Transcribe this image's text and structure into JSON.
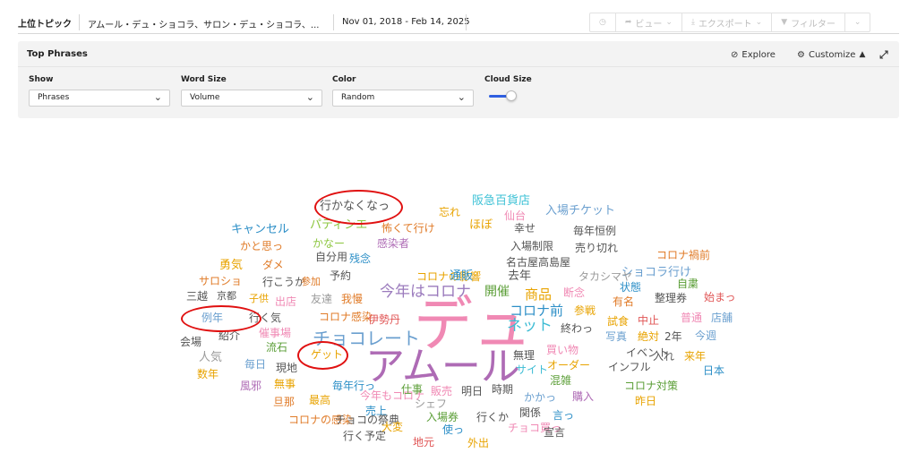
{
  "header": {
    "title": "上位トピック",
    "query": "アムール・デュ・ショコラ、サロン・デュ・ショコラ、...",
    "date_range": "Nov 01, 2018 - Feb 14, 2025",
    "controls": {
      "view_label": "ビュー",
      "export_label": "エクスポート",
      "filter_label": "フィルター"
    }
  },
  "panel": {
    "title": "Top Phrases",
    "explore_label": "Explore",
    "customize_label": "Customize",
    "fields": {
      "show": {
        "label": "Show",
        "value": "Phrases"
      },
      "word_size": {
        "label": "Word Size",
        "value": "Volume"
      },
      "color": {
        "label": "Color",
        "value": "Random"
      },
      "cloud_size": {
        "label": "Cloud Size"
      }
    }
  },
  "cloud_words": [
    {
      "text": "デュ",
      "color": "#f089b4"
    },
    {
      "text": "アムール",
      "color": "#ae6bb5"
    },
    {
      "text": "チョコレート",
      "color": "#6a9fcf"
    },
    {
      "text": "今年はコロナ",
      "color": "#9b7bbd"
    },
    {
      "text": "ネット",
      "color": "#3dbcd4"
    },
    {
      "text": "コロナ前",
      "color": "#2d8fc7"
    },
    {
      "text": "商品",
      "color": "#e8a300"
    },
    {
      "text": "開催",
      "color": "#5b9e37"
    },
    {
      "text": "行かなくなっ",
      "color": "#555555"
    },
    {
      "text": "阪急百貨店",
      "color": "#3ec2d6"
    },
    {
      "text": "忘れ",
      "color": "#e8a300"
    },
    {
      "text": "仙台",
      "color": "#f089b4"
    },
    {
      "text": "入場チケット",
      "color": "#6a9fcf"
    },
    {
      "text": "キャンセル",
      "color": "#2d8fc7"
    },
    {
      "text": "パティシエ",
      "color": "#8cc63f"
    },
    {
      "text": "ほぼ",
      "color": "#e8a300"
    },
    {
      "text": "幸せ",
      "color": "#555555"
    },
    {
      "text": "怖くて行け",
      "color": "#e07b28"
    },
    {
      "text": "毎年恒例",
      "color": "#555555"
    },
    {
      "text": "かと思っ",
      "color": "#e07b28"
    },
    {
      "text": "かなー",
      "color": "#8cc63f"
    },
    {
      "text": "感染者",
      "color": "#ae6bb5"
    },
    {
      "text": "入場制限",
      "color": "#555555"
    },
    {
      "text": "売り切れ",
      "color": "#555555"
    },
    {
      "text": "コロナ禍前",
      "color": "#e07b28"
    },
    {
      "text": "勇気",
      "color": "#e8a300"
    },
    {
      "text": "ダメ",
      "color": "#e07b28"
    },
    {
      "text": "自分用",
      "color": "#555555"
    },
    {
      "text": "残念",
      "color": "#2d8fc7"
    },
    {
      "text": "名古屋高島屋",
      "color": "#555555"
    },
    {
      "text": "ショコラ行け",
      "color": "#6a9fcf"
    },
    {
      "text": "サロショ",
      "color": "#e07b28"
    },
    {
      "text": "行こうか",
      "color": "#555555"
    },
    {
      "text": "参加",
      "color": "#e07b28"
    },
    {
      "text": "予約",
      "color": "#555555"
    },
    {
      "text": "コロナの影響",
      "color": "#e8a300"
    },
    {
      "text": "通販",
      "color": "#2d8fc7"
    },
    {
      "text": "去年",
      "color": "#555555"
    },
    {
      "text": "タカシマヤ",
      "color": "#9b9b9b"
    },
    {
      "text": "自粛",
      "color": "#5b9e37"
    },
    {
      "text": "状態",
      "color": "#2d8fc7"
    },
    {
      "text": "三越",
      "color": "#555555"
    },
    {
      "text": "京都",
      "color": "#555555"
    },
    {
      "text": "子供",
      "color": "#e8a300"
    },
    {
      "text": "出店",
      "color": "#f089b4"
    },
    {
      "text": "友達",
      "color": "#9b9b9b"
    },
    {
      "text": "我慢",
      "color": "#e07b28"
    },
    {
      "text": "断念",
      "color": "#f089b4"
    },
    {
      "text": "整理券",
      "color": "#555555"
    },
    {
      "text": "始まっ",
      "color": "#e05555"
    },
    {
      "text": "有名",
      "color": "#e07b28"
    },
    {
      "text": "例年",
      "color": "#6a9fcf"
    },
    {
      "text": "行く気",
      "color": "#555555"
    },
    {
      "text": "コロナ感染",
      "color": "#e07b28"
    },
    {
      "text": "伊勢丹",
      "color": "#e05555"
    },
    {
      "text": "参戦",
      "color": "#e8a300"
    },
    {
      "text": "試食",
      "color": "#e8a300"
    },
    {
      "text": "中止",
      "color": "#e05555"
    },
    {
      "text": "普通",
      "color": "#f089b4"
    },
    {
      "text": "店舗",
      "color": "#6a9fcf"
    },
    {
      "text": "紹介",
      "color": "#555555"
    },
    {
      "text": "催事場",
      "color": "#f089b4"
    },
    {
      "text": "終わっ",
      "color": "#555555"
    },
    {
      "text": "会場",
      "color": "#555555"
    },
    {
      "text": "写真",
      "color": "#6a9fcf"
    },
    {
      "text": "絶対",
      "color": "#e8a300"
    },
    {
      "text": "2年",
      "color": "#555555"
    },
    {
      "text": "今週",
      "color": "#6a9fcf"
    },
    {
      "text": "流石",
      "color": "#5b9e37"
    },
    {
      "text": "買い物",
      "color": "#f089b4"
    },
    {
      "text": "イベント",
      "color": "#555555"
    },
    {
      "text": "入れ",
      "color": "#555555"
    },
    {
      "text": "人気",
      "color": "#9b9b9b"
    },
    {
      "text": "ゲット",
      "color": "#e8a300"
    },
    {
      "text": "無理",
      "color": "#555555"
    },
    {
      "text": "来年",
      "color": "#e8a300"
    },
    {
      "text": "毎日",
      "color": "#6a9fcf"
    },
    {
      "text": "現地",
      "color": "#555555"
    },
    {
      "text": "オーダー",
      "color": "#e8a300"
    },
    {
      "text": "インフル",
      "color": "#555555"
    },
    {
      "text": "数年",
      "color": "#e8a300"
    },
    {
      "text": "サイト",
      "color": "#3dbcd4"
    },
    {
      "text": "日本",
      "color": "#2d8fc7"
    },
    {
      "text": "風邪",
      "color": "#ae6bb5"
    },
    {
      "text": "無事",
      "color": "#e8a300"
    },
    {
      "text": "毎年行っ",
      "color": "#2d8fc7"
    },
    {
      "text": "混雑",
      "color": "#5b9e37"
    },
    {
      "text": "コロナ対策",
      "color": "#5b9e37"
    },
    {
      "text": "今年もコロナ",
      "color": "#f089b4"
    },
    {
      "text": "仕事",
      "color": "#5b9e37"
    },
    {
      "text": "販売",
      "color": "#f089b4"
    },
    {
      "text": "明日",
      "color": "#555555"
    },
    {
      "text": "時期",
      "color": "#555555"
    },
    {
      "text": "購入",
      "color": "#ae6bb5"
    },
    {
      "text": "旦那",
      "color": "#e07b28"
    },
    {
      "text": "最高",
      "color": "#e8a300"
    },
    {
      "text": "シェフ",
      "color": "#9b9b9b"
    },
    {
      "text": "かかっ",
      "color": "#6a9fcf"
    },
    {
      "text": "昨日",
      "color": "#e8a300"
    },
    {
      "text": "コロナの感染",
      "color": "#e07b28"
    },
    {
      "text": "売上",
      "color": "#2d8fc7"
    },
    {
      "text": "入場券",
      "color": "#5b9e37"
    },
    {
      "text": "行くか",
      "color": "#555555"
    },
    {
      "text": "関係",
      "color": "#555555"
    },
    {
      "text": "言っ",
      "color": "#2d8fc7"
    },
    {
      "text": "チョコの祭典",
      "color": "#555555"
    },
    {
      "text": "大変",
      "color": "#e8a300"
    },
    {
      "text": "使っ",
      "color": "#2d8fc7"
    },
    {
      "text": "チョコ買っ",
      "color": "#f089b4"
    },
    {
      "text": "宣言",
      "color": "#555555"
    },
    {
      "text": "行く予定",
      "color": "#555555"
    },
    {
      "text": "地元",
      "color": "#e05555"
    },
    {
      "text": "外出",
      "color": "#e8a300"
    },
    {
      "text": "終了",
      "color": "#8cc63f"
    }
  ]
}
